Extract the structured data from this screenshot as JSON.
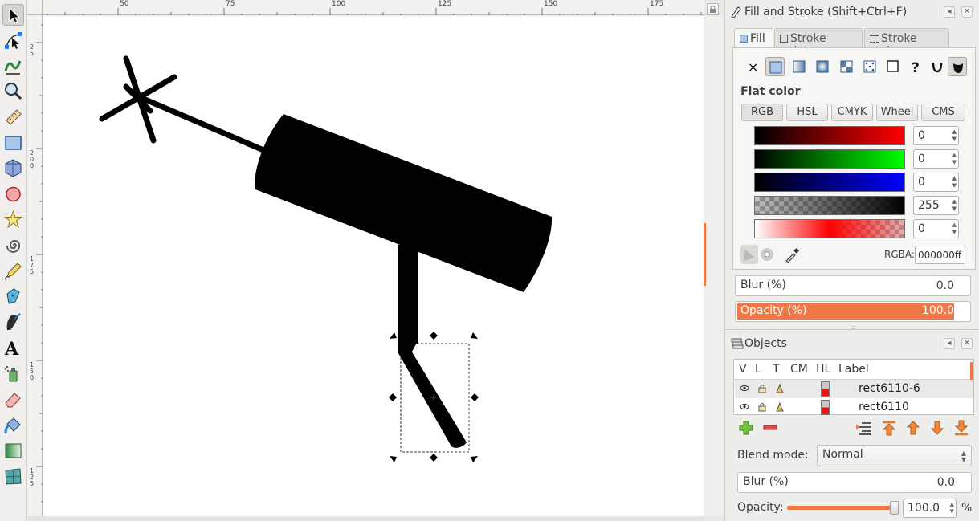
{
  "toolbox": {
    "tools": [
      {
        "name": "selector-tool-icon",
        "active": true
      },
      {
        "name": "node-tool-icon"
      },
      {
        "name": "tweak-tool-icon"
      },
      {
        "name": "zoom-tool-icon"
      },
      {
        "name": "measure-tool-icon"
      },
      {
        "name": "rectangle-tool-icon"
      },
      {
        "name": "3d-box-tool-icon"
      },
      {
        "name": "ellipse-tool-icon"
      },
      {
        "name": "star-tool-icon"
      },
      {
        "name": "spiral-tool-icon"
      },
      {
        "name": "pencil-tool-icon"
      },
      {
        "name": "pen-tool-icon"
      },
      {
        "name": "calligraphy-tool-icon"
      },
      {
        "name": "text-tool-icon"
      },
      {
        "name": "spray-tool-icon"
      },
      {
        "name": "eraser-tool-icon"
      },
      {
        "name": "paint-bucket-tool-icon"
      },
      {
        "name": "gradient-tool-icon"
      },
      {
        "name": "mesh-tool-icon"
      }
    ]
  },
  "ruler": {
    "top_labels": [
      "50",
      "75",
      "100",
      "125",
      "150",
      "175"
    ],
    "left_labels": [
      "25",
      "200",
      "175",
      "150",
      "125"
    ]
  },
  "fill_stroke": {
    "title": "Fill and Stroke (Shift+Ctrl+F)",
    "tabs": [
      "Fill",
      "Stroke paint",
      "Stroke style"
    ],
    "active_tab": "Fill",
    "mode_label": "Flat color",
    "color_systems": [
      "RGB",
      "HSL",
      "CMYK",
      "Wheel",
      "CMS"
    ],
    "active_system": "RGB",
    "channels": [
      {
        "name": "red",
        "value": "0"
      },
      {
        "name": "green",
        "value": "0"
      },
      {
        "name": "blue",
        "value": "0"
      },
      {
        "name": "alpha",
        "value": "255"
      },
      {
        "name": "extra",
        "value": "0"
      }
    ],
    "rgba_label": "RGBA:",
    "rgba_value": "000000ff",
    "blur_label": "Blur (%)",
    "blur_value": "0.0",
    "opacity_label": "Opacity (%)",
    "opacity_value": "100.0",
    "accent_color": "#f07746"
  },
  "objects": {
    "title": "Objects",
    "columns": [
      "V",
      "L",
      "T",
      "CM",
      "HL",
      "Label"
    ],
    "rows": [
      {
        "label": "rect6110-6",
        "selected": true
      },
      {
        "label": "rect6110",
        "selected": false
      }
    ],
    "blend_label": "Blend mode:",
    "blend_value": "Normal",
    "blur_label": "Blur (%)",
    "blur_value": "0.0",
    "opacity_label": "Opacity:",
    "opacity_value": "100.0",
    "opacity_unit": "%"
  }
}
